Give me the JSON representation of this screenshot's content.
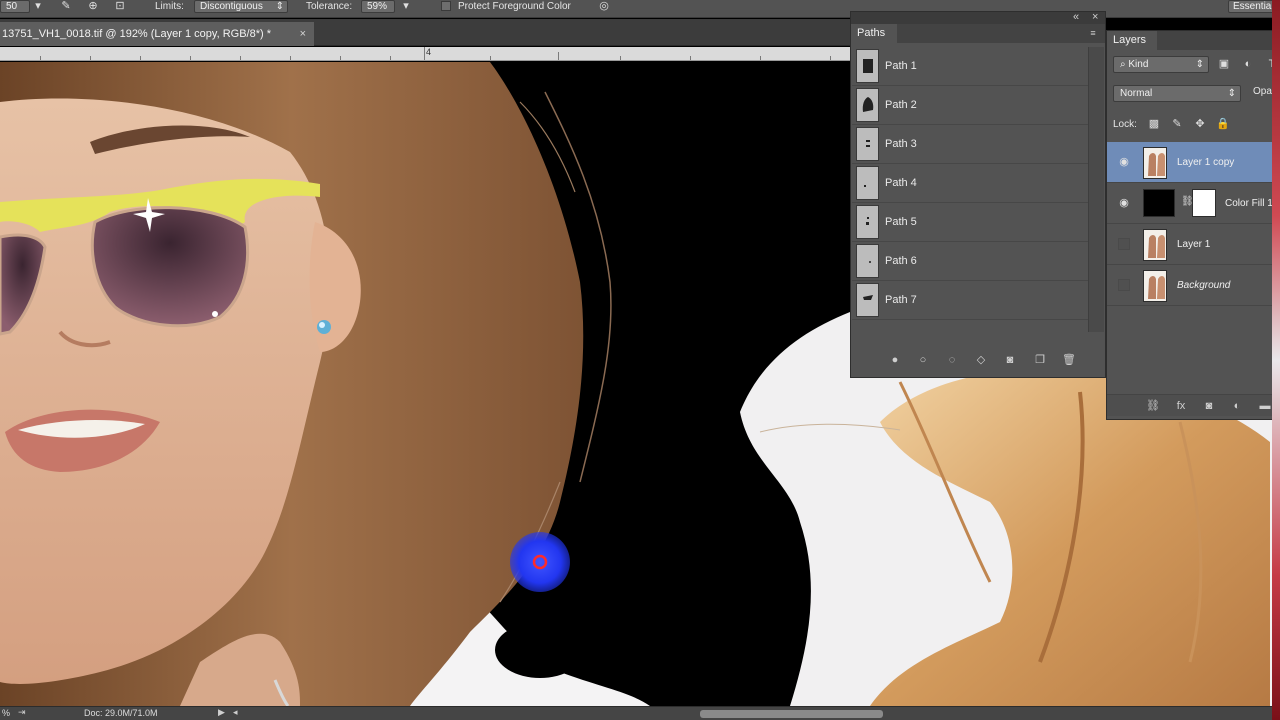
{
  "options_bar": {
    "brush_size": "50",
    "limits_label": "Limits:",
    "limits_value": "Discontiguous",
    "tolerance_label": "Tolerance:",
    "tolerance_value": "59%",
    "protect_fg_label": "Protect Foreground Color",
    "workspace": "Essentials"
  },
  "document": {
    "tab_title": "13751_VH1_0018.tif @ 192% (Layer 1 copy, RGB/8*) *",
    "close_glyph": "×",
    "ruler_label": "4"
  },
  "status_bar": {
    "zoom": "%",
    "doc_info": "Doc: 29.0M/71.0M"
  },
  "paths_panel": {
    "title": "Paths",
    "items": [
      {
        "label": "Path 1"
      },
      {
        "label": "Path 2"
      },
      {
        "label": "Path 3"
      },
      {
        "label": "Path 4"
      },
      {
        "label": "Path 5"
      },
      {
        "label": "Path 6"
      },
      {
        "label": "Path 7"
      }
    ],
    "footer_icons": [
      "fill-path-icon",
      "stroke-path-icon",
      "load-selection-icon",
      "make-work-path-icon",
      "add-mask-icon",
      "new-path-icon",
      "delete-path-icon"
    ]
  },
  "layers_panel": {
    "title": "Layers",
    "filter_kind": "Kind",
    "blend_mode": "Normal",
    "opacity_label": "Opa",
    "lock_label": "Lock:",
    "layers": [
      {
        "name": "Layer 1 copy",
        "visible": true,
        "selected": true
      },
      {
        "name": "Color Fill 1",
        "visible": true,
        "selected": false
      },
      {
        "name": "Layer 1",
        "visible": false,
        "selected": false
      },
      {
        "name": "Background",
        "visible": false,
        "selected": false
      }
    ]
  },
  "colors": {
    "panel_bg": "#535353",
    "selected_layer": "#6f8cb8",
    "brush_cursor": "#2233ff"
  }
}
